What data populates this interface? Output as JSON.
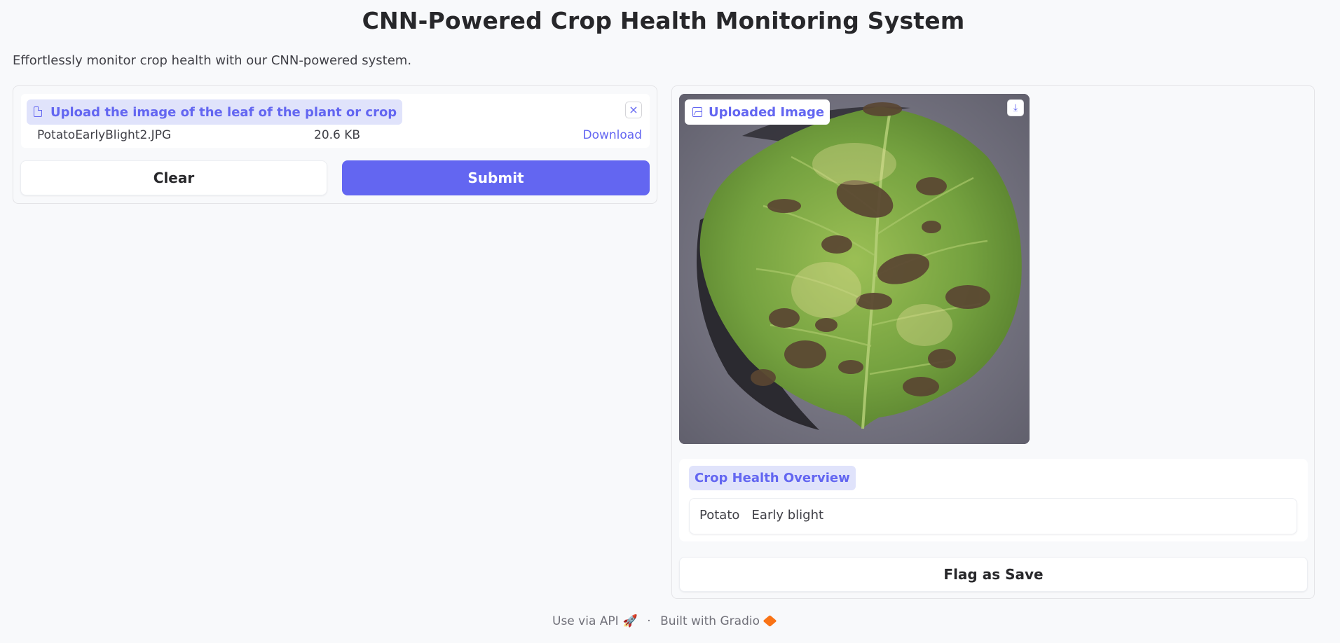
{
  "header": {
    "title": "CNN-Powered Crop Health Monitoring System",
    "description": "Effortlessly monitor crop health with our CNN-powered system."
  },
  "input": {
    "upload_label": "Upload the image of the leaf of the plant or crop",
    "file_name": "PotatoEarlyBlight2.JPG",
    "file_size": "20.6 KB",
    "download_link": "Download",
    "clear_label": "Clear",
    "submit_label": "Submit"
  },
  "output": {
    "image_label": "Uploaded Image",
    "overview_label": "Crop Health Overview",
    "overview_value": "Potato   Early blight",
    "flag_label": "Flag as Save"
  },
  "footer": {
    "api_text": "Use via API",
    "separator": "·",
    "built_text": "Built with Gradio"
  },
  "colors": {
    "accent": "#6366f1",
    "label_bg": "#e0e3fb",
    "page_bg": "#f8f9fb"
  }
}
